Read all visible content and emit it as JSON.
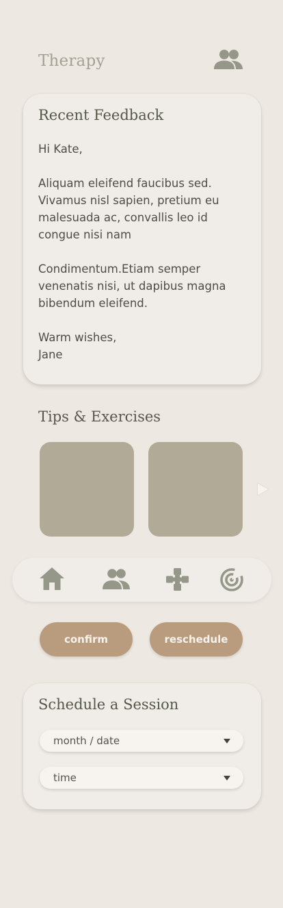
{
  "header": {
    "title": "Therapy",
    "icon": "people-icon"
  },
  "feedback": {
    "title": "Recent Feedback",
    "greeting": "Hi Kate,",
    "paragraph1": "Aliquam eleifend faucibus sed. Vivamus nisl sapien, pretium eu malesuada ac, convallis leo id congue nisi nam",
    "paragraph2": "Condimentum.Etiam semper venenatis nisi, ut dapibus magna bibendum eleifend.",
    "signoff": "Warm wishes,",
    "signature": "Jane"
  },
  "tips": {
    "title": "Tips & Exercises",
    "next_icon": "chevron-right-icon"
  },
  "nav": {
    "items": [
      {
        "icon": "home-icon"
      },
      {
        "icon": "people-icon"
      },
      {
        "icon": "gamepad-icon"
      },
      {
        "icon": "progress-icon"
      }
    ]
  },
  "actions": {
    "confirm_label": "confirm",
    "reschedule_label": "reschedule"
  },
  "schedule": {
    "title": "Schedule a Session",
    "date_placeholder": "month / date",
    "time_placeholder": "time"
  },
  "colors": {
    "background": "#ede8e2",
    "card": "#f0ece7",
    "tile": "#b1aa97",
    "accent": "#b89c7d",
    "icon": "#959788"
  }
}
